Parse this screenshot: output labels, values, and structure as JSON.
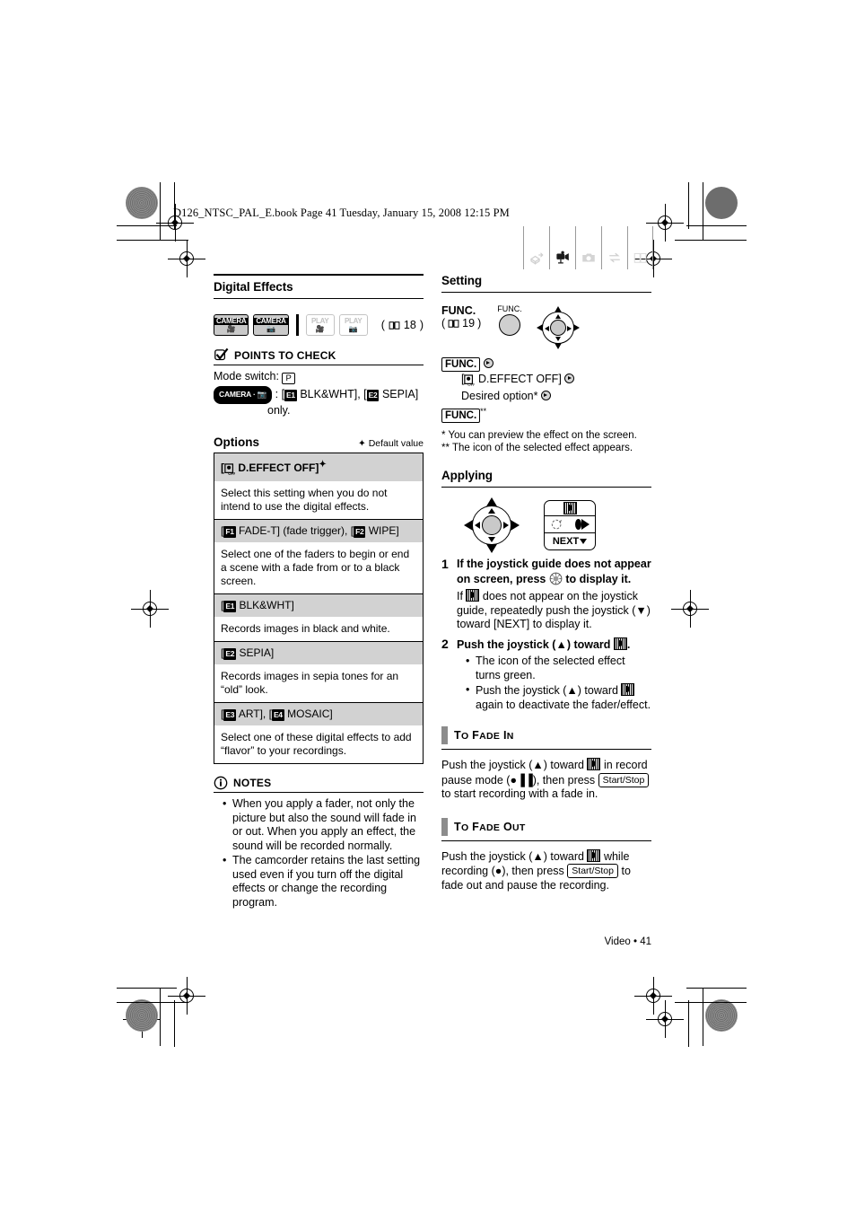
{
  "header": {
    "slug": "D126_NTSC_PAL_E.book  Page 41  Tuesday, January 15, 2008  12:15 PM"
  },
  "tabs": [
    {
      "name": "introduction-tab",
      "label": "intro-icon",
      "active": false
    },
    {
      "name": "video-tab",
      "label": "camcorder-icon",
      "active": true
    },
    {
      "name": "photos-tab",
      "label": "camera-icon",
      "active": false
    },
    {
      "name": "external-connections-tab",
      "label": "transfer-icon",
      "active": false
    },
    {
      "name": "additional-information-tab",
      "label": "book-icon",
      "active": false
    }
  ],
  "left": {
    "section_title": "Digital Effects",
    "modes": [
      {
        "word": "CAMERA",
        "glyph": "movie",
        "enabled": true
      },
      {
        "word": "CAMERA",
        "glyph": "photo",
        "enabled": true
      },
      {
        "word": "PLAY",
        "glyph": "movie",
        "enabled": false
      },
      {
        "word": "PLAY",
        "glyph": "photo",
        "enabled": false
      }
    ],
    "mode_page_ref": "18",
    "points_to_check": {
      "title": "POINTS TO CHECK",
      "line1_label": "Mode switch:",
      "line1_value": "P",
      "line2_mode": "CAMERA",
      "line2_text_a": ": [",
      "line2_e1": "E1",
      "line2_text_b": "BLK&WHT], [",
      "line2_e2": "E2",
      "line2_text_c": "SEPIA]",
      "line3_text": "only."
    },
    "options": {
      "title": "Options",
      "default_note": "Default value",
      "rows": [
        {
          "head": "[  D.EFFECT OFF]",
          "head_bold": true,
          "icons": [
            "d-effect-off"
          ],
          "desc": "Select this setting when you do not intend to use the digital effects."
        },
        {
          "head": "[ F1 FADE-T] (fade trigger), [ F2 WIPE]",
          "head_bold": false,
          "icons": [
            "F1",
            "F2"
          ],
          "desc": "Select one of the faders to begin or end a scene with a fade from or to a black screen."
        },
        {
          "head": "[ E1 BLK&WHT]",
          "head_bold": false,
          "icons": [
            "E1"
          ],
          "desc": "Records images in black and white."
        },
        {
          "head": "[ E2 SEPIA]",
          "head_bold": false,
          "icons": [
            "E2"
          ],
          "desc": "Records images in sepia tones for an “old” look."
        },
        {
          "head": "[ E3 ART], [ E4 MOSAIC]",
          "head_bold": false,
          "icons": [
            "E3",
            "E4"
          ],
          "desc": "Select one of these digital effects to add “flavor” to your recordings."
        }
      ]
    },
    "notes": {
      "title": "NOTES",
      "items": [
        "When you apply a fader, not only the picture but also the sound will fade in or out. When you apply an effect, the sound will be recorded normally.",
        "The camcorder retains the last setting used even if you turn off the digital effects or change the recording program."
      ]
    }
  },
  "right": {
    "setting": {
      "title": "Setting",
      "func_label": "FUNC.",
      "func_page_ref": "19",
      "button_caption": "FUNC.",
      "steps": [
        {
          "button": "FUNC.",
          "text": ""
        },
        {
          "button": "",
          "text": "[  D.EFFECT OFF]"
        },
        {
          "button": "",
          "text": "Desired option*"
        },
        {
          "button": "FUNC.",
          "text": "**"
        }
      ],
      "footnote1": "*  You can preview the effect on the screen.",
      "footnote2": "** The icon of the selected effect appears."
    },
    "applying": {
      "title": "Applying",
      "guide_next_label": "NEXT",
      "steps": [
        {
          "num": "1",
          "bold": "If the joystick guide does not appear on screen, press",
          "bold_after": "to display it.",
          "body_before": "If",
          "body_after": "does not appear on the joystick guide, repeatedly push the joystick (▼) toward [NEXT] to display it."
        },
        {
          "num": "2",
          "bold": "Push the joystick (▲) toward",
          "bold_after": ".",
          "bullets": [
            {
              "before": "The icon of the selected effect turns green.",
              "after": ""
            },
            {
              "before": "Push the joystick (▲) toward",
              "after": "again to deactivate the fader/effect."
            }
          ]
        }
      ]
    },
    "fade_in": {
      "title_cap": "T",
      "title": "To Fade In",
      "text_a": "Push the joystick (▲) toward",
      "text_b": "in record pause mode (",
      "text_c": "), then press",
      "button": "Start/Stop",
      "text_d": "to start recording with a fade in."
    },
    "fade_out": {
      "title": "To Fade Out",
      "text_a": "Push the joystick (▲) toward",
      "text_b": "while recording (",
      "text_c": "), then press",
      "button": "Start/Stop",
      "text_d": "to fade out and pause the recording."
    }
  },
  "footer": {
    "text": "Video • 41"
  }
}
